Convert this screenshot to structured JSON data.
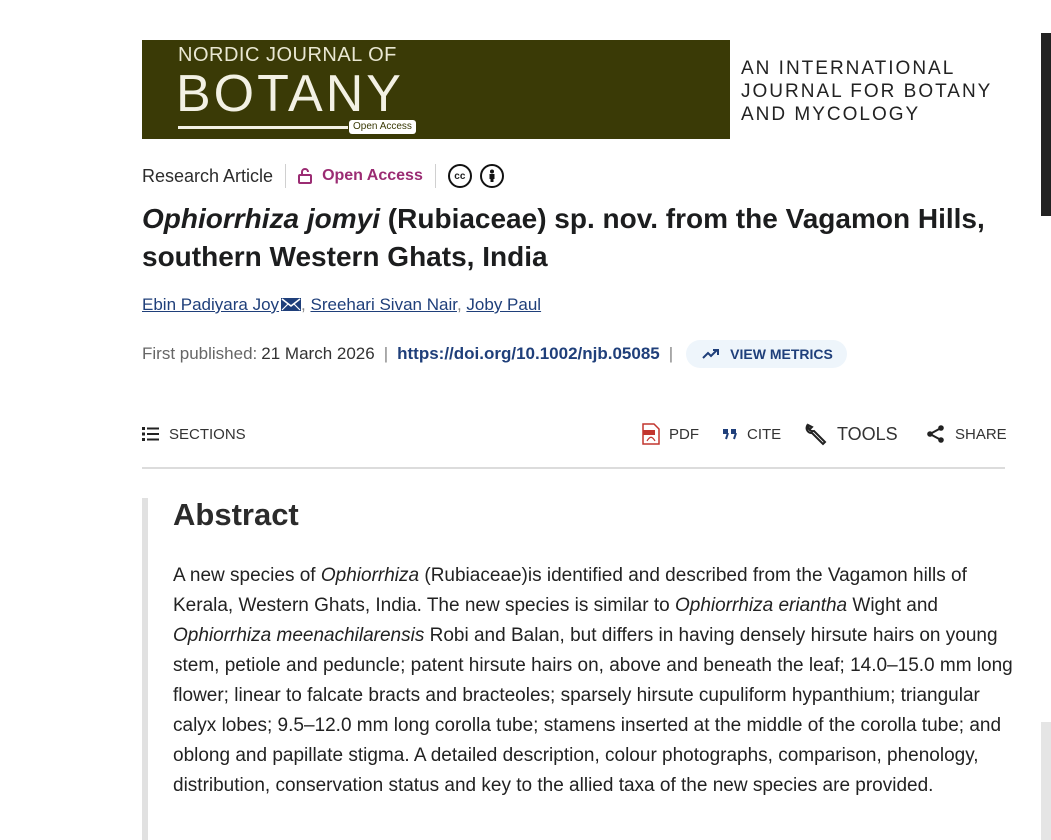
{
  "banner": {
    "line1": "NORDIC JOURNAL OF",
    "line2": "BOTANY",
    "badge": "Open Access",
    "tagline1": "AN INTERNATIONAL",
    "tagline2": "JOURNAL FOR BOTANY",
    "tagline3": "AND MYCOLOGY",
    "bg_color": "#3a3a06"
  },
  "meta": {
    "article_type": "Research Article",
    "open_access": "Open Access",
    "cc_icons": [
      "cc-icon",
      "by-icon"
    ]
  },
  "title": {
    "species": "Ophiorrhiza jomyi",
    "rest": " (Rubiaceae) sp. nov. from the Vagamon Hills, southern Western Ghats, India"
  },
  "authors": [
    "Ebin Padiyara Joy",
    "Sreehari Sivan Nair",
    "Joby Paul"
  ],
  "pub": {
    "first_published_label": "First published:",
    "date": "21 March 2026",
    "doi": "https://doi.org/10.1002/njb.05085",
    "metrics_label": "VIEW METRICS"
  },
  "toolbar": {
    "sections": "SECTIONS",
    "pdf": "PDF",
    "cite": "CITE",
    "tools": "TOOLS",
    "share": "SHARE"
  },
  "abstract": {
    "heading": "Abstract",
    "segments": [
      {
        "t": "A new species of "
      },
      {
        "t": "Ophiorrhiza",
        "i": true
      },
      {
        "t": " (Rubiaceae)is identified and described from the Vagamon hills of Kerala, Western Ghats, India. The new species is similar to "
      },
      {
        "t": "Ophiorrhiza eriantha",
        "i": true
      },
      {
        "t": " Wight and "
      },
      {
        "t": "Ophiorrhiza meenachilarensis",
        "i": true
      },
      {
        "t": " Robi and Balan, but differs in having densely hirsute hairs on young stem, petiole and peduncle; patent hirsute hairs on, above and beneath the leaf; 14.0–15.0 mm long flower; linear to falcate bracts and bracteoles; sparsely hirsute cupuliform hypanthium; triangular calyx lobes; 9.5–12.0 mm long corolla tube; stamens inserted at the middle of the corolla tube; and oblong and papillate stigma. A detailed description, colour photographs, comparison, phenology, distribution, conservation status and key to the allied taxa of the new species are provided."
      }
    ]
  }
}
